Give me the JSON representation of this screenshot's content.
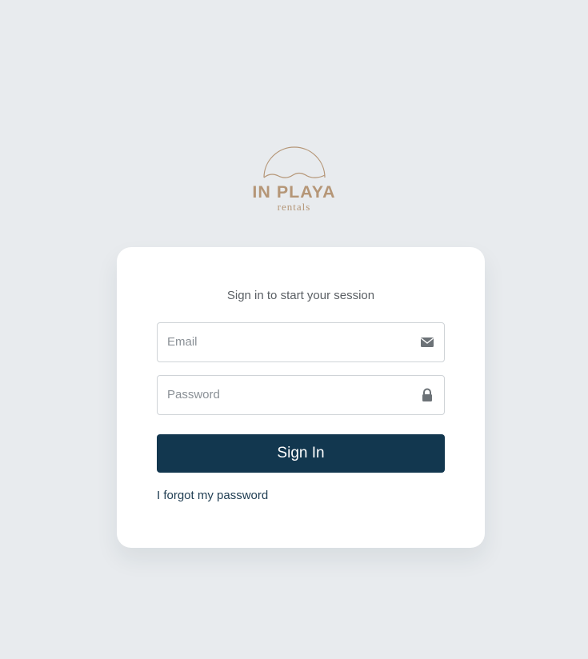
{
  "brand": {
    "title": "IN PLAYA",
    "subtitle": "rentals",
    "color": "#b59677"
  },
  "login": {
    "message": "Sign in to start your session",
    "email": {
      "placeholder": "Email",
      "value": "",
      "icon": "envelope-icon"
    },
    "password": {
      "placeholder": "Password",
      "value": "",
      "icon": "lock-icon"
    },
    "submit_label": "Sign In",
    "forgot_label": "I forgot my password"
  },
  "colors": {
    "background": "#e8ebee",
    "card": "#ffffff",
    "button": "#12374f",
    "button_text": "#ffffff",
    "link": "#1f3d52"
  }
}
